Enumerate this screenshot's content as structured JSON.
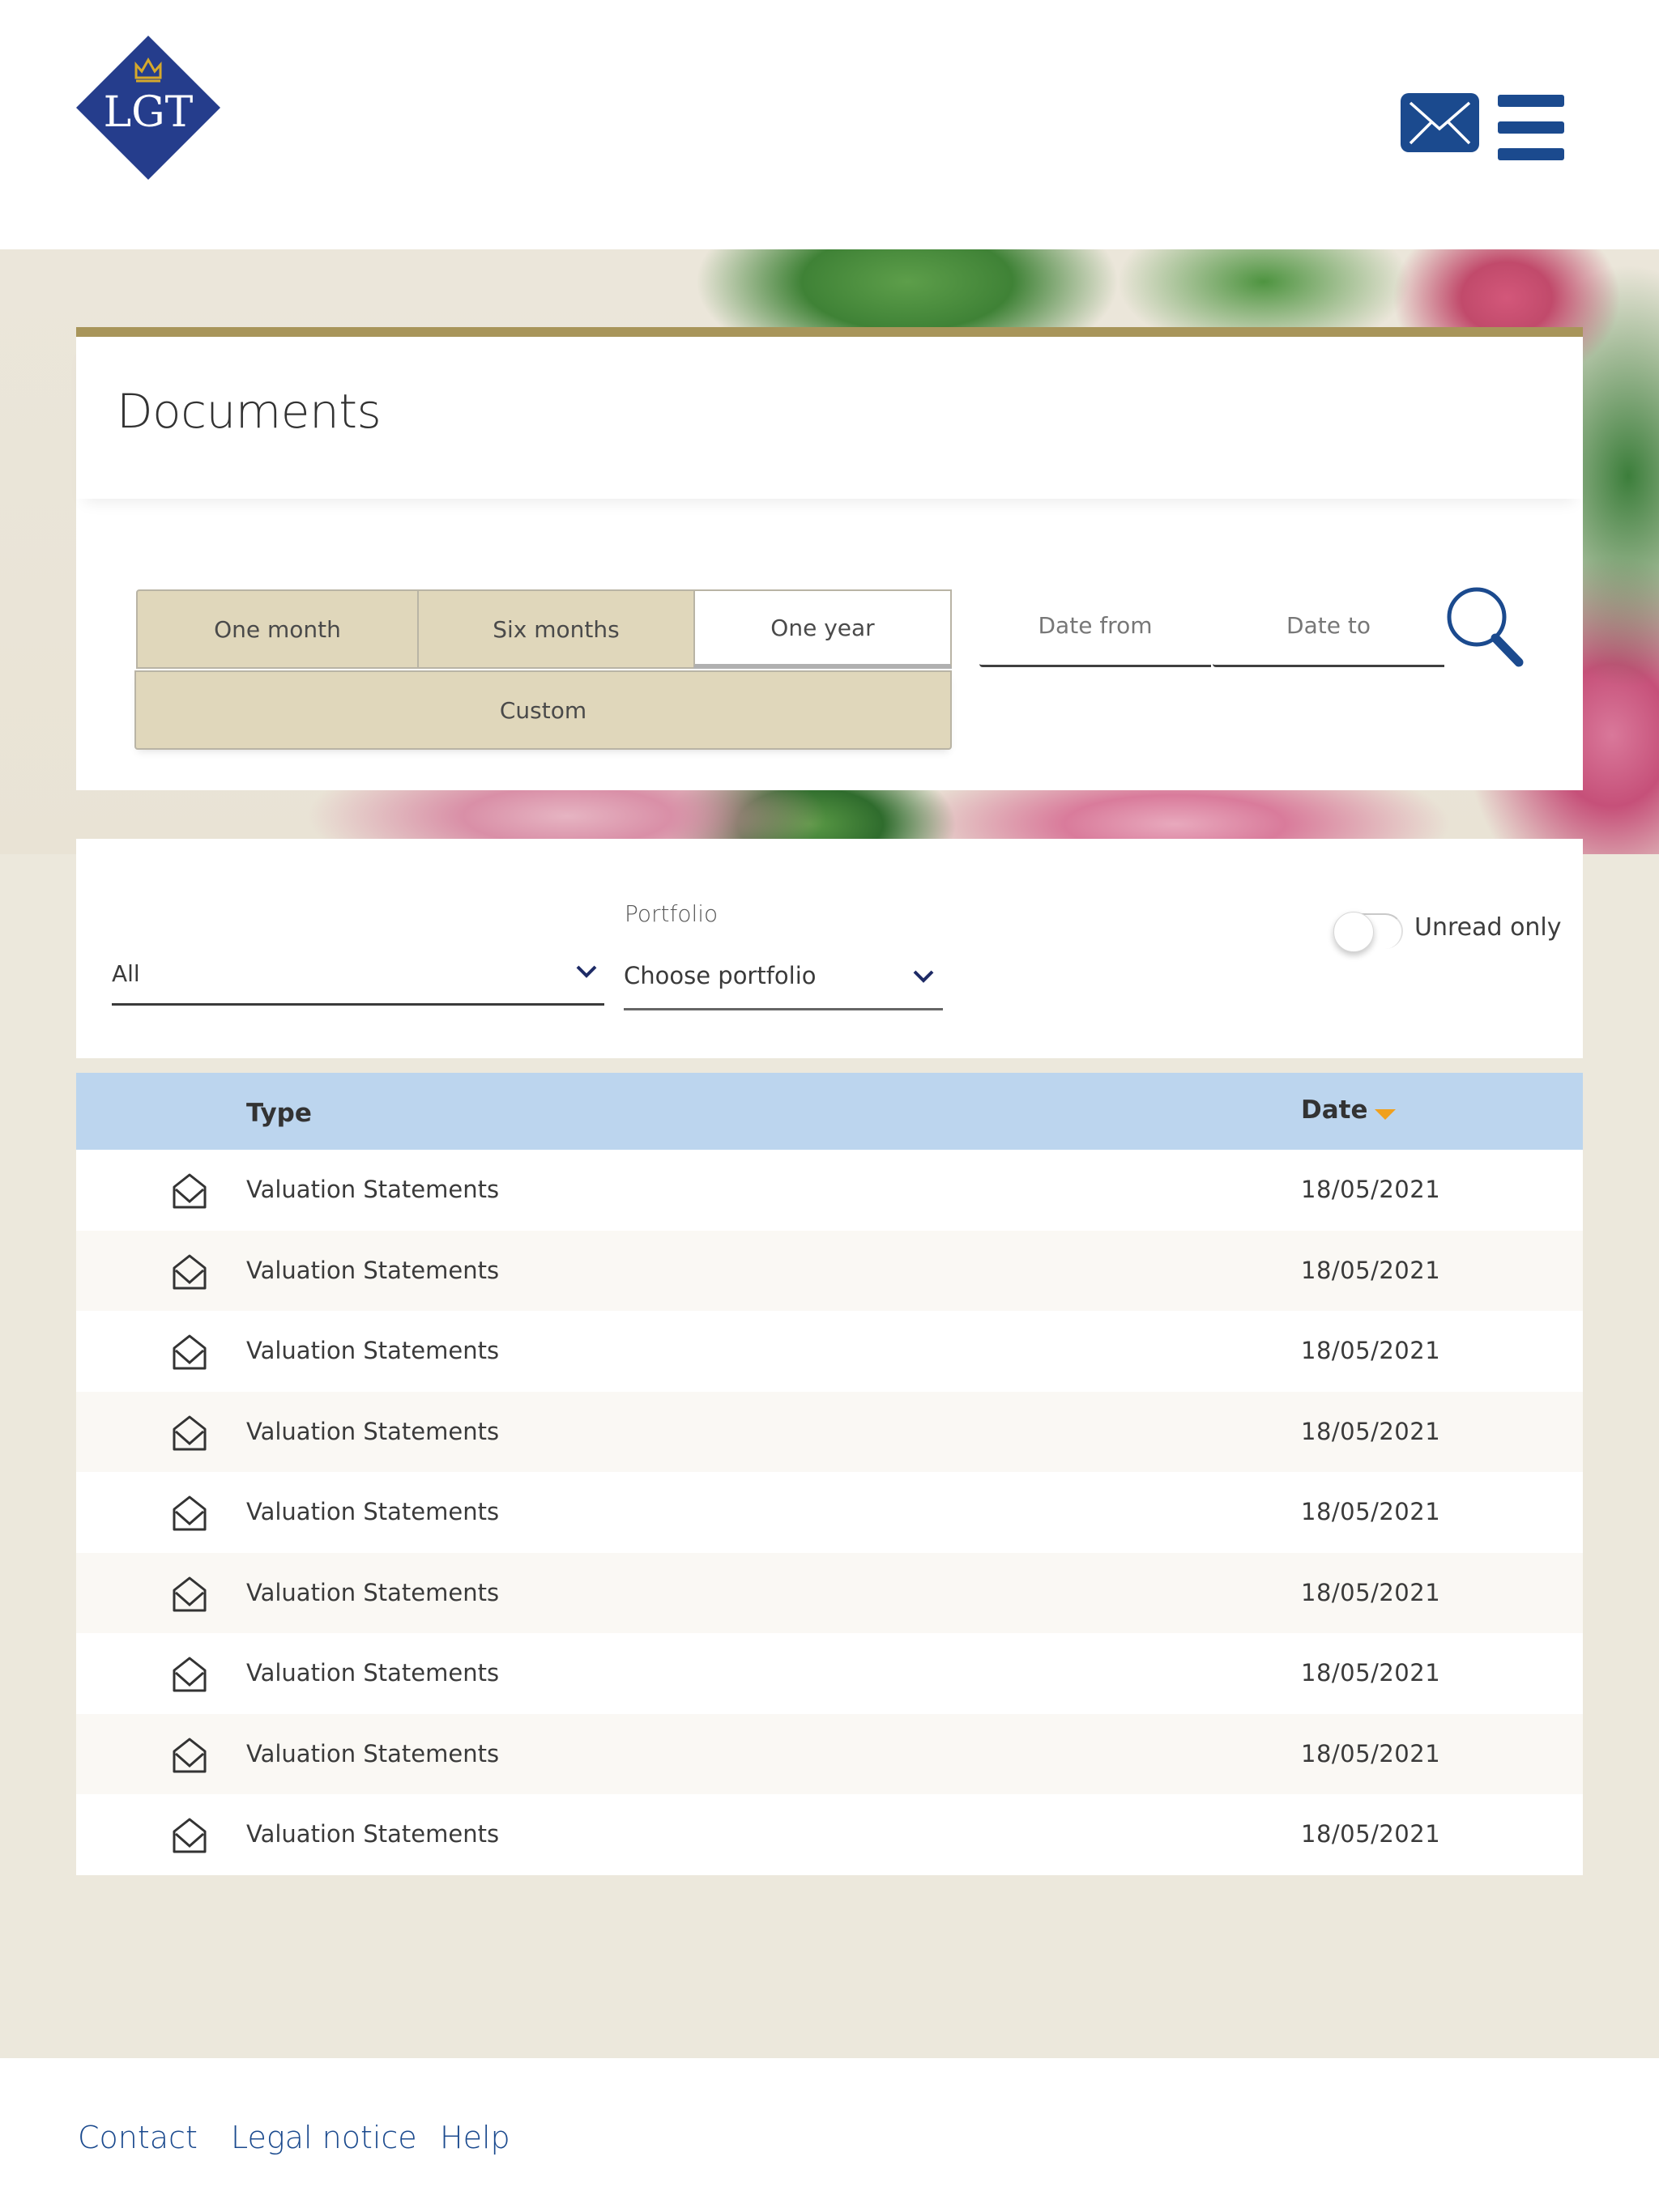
{
  "header": {
    "logo_text": "LGT",
    "mail_icon": "envelope-icon",
    "menu_icon": "hamburger-menu-icon"
  },
  "documents": {
    "title": "Documents",
    "period_buttons": [
      {
        "label": "One month",
        "active": false
      },
      {
        "label": "Six months",
        "active": false
      },
      {
        "label": "One year",
        "active": true
      }
    ],
    "custom_label": "Custom",
    "date_from_placeholder": "Date from",
    "date_to_placeholder": "Date to",
    "search_icon": "magnifier-icon"
  },
  "filters": {
    "type_value": "All",
    "portfolio_label": "Portfolio",
    "portfolio_value": "Choose portfolio",
    "unread_only_label": "Unread only",
    "unread_only_on": false
  },
  "table": {
    "columns": {
      "type": "Type",
      "date": "Date"
    },
    "sort": {
      "column": "Date",
      "direction": "descending"
    },
    "rows": [
      {
        "type": "Valuation Statements",
        "date": "18/05/2021",
        "icon": "open-envelope-icon"
      },
      {
        "type": "Valuation Statements",
        "date": "18/05/2021",
        "icon": "open-envelope-icon"
      },
      {
        "type": "Valuation Statements",
        "date": "18/05/2021",
        "icon": "open-envelope-icon"
      },
      {
        "type": "Valuation Statements",
        "date": "18/05/2021",
        "icon": "open-envelope-icon"
      },
      {
        "type": "Valuation Statements",
        "date": "18/05/2021",
        "icon": "open-envelope-icon"
      },
      {
        "type": "Valuation Statements",
        "date": "18/05/2021",
        "icon": "open-envelope-icon"
      },
      {
        "type": "Valuation Statements",
        "date": "18/05/2021",
        "icon": "open-envelope-icon"
      },
      {
        "type": "Valuation Statements",
        "date": "18/05/2021",
        "icon": "open-envelope-icon"
      },
      {
        "type": "Valuation Statements",
        "date": "18/05/2021",
        "icon": "open-envelope-icon"
      }
    ]
  },
  "footer": {
    "links": [
      "Contact",
      "Legal notice",
      "Help"
    ]
  },
  "colors": {
    "brand_blue": "#1b4a8e",
    "logo_blue": "#253d8c",
    "crown_gold": "#d6a92b",
    "card_accent_gold": "#a8955a",
    "period_button_bg": "#e0d7bb",
    "table_header_bg": "#bcd5ee",
    "sort_arrow": "#f0a01c",
    "page_bg": "#ece8dc"
  }
}
